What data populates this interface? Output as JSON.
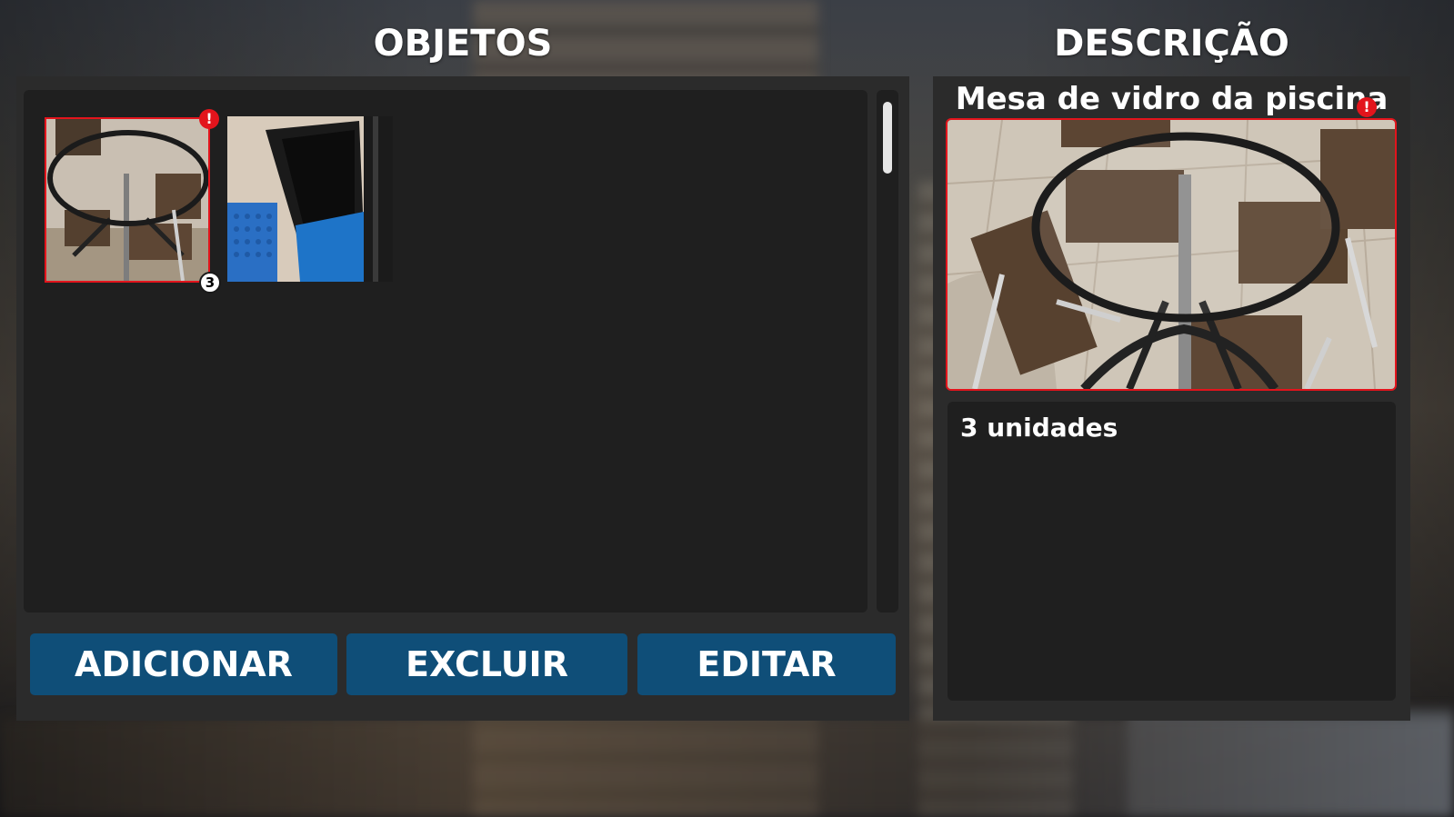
{
  "colors": {
    "panel": "#2b2b2b",
    "inner": "#1f1f1f",
    "button": "#0f4e78",
    "alert": "#e3141c",
    "text": "#ffffff"
  },
  "objects_section": {
    "title": "OBJETOS",
    "items": [
      {
        "image": "glass-table-photo",
        "selected": true,
        "alert_icon": "exclamation-icon",
        "alert_text": "!",
        "count": "3"
      },
      {
        "image": "blue-trash-bin-photo",
        "selected": false
      }
    ],
    "buttons": {
      "add": "ADICIONAR",
      "delete": "EXCLUIR",
      "edit": "EDITAR"
    }
  },
  "description_section": {
    "title": "DESCRIÇÃO",
    "object_name": "Mesa de vidro da piscina",
    "alert_text": "!",
    "image": "glass-table-photo",
    "description": "3 unidades"
  }
}
